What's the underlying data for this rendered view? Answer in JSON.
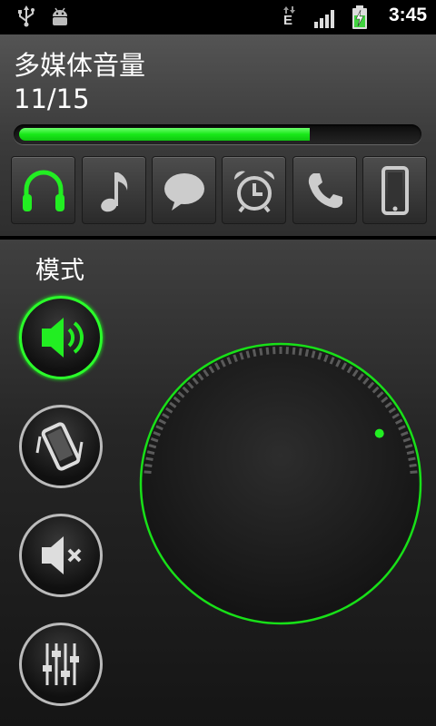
{
  "status_bar": {
    "time": "3:45",
    "network_type": "E",
    "icons": [
      "usb-icon",
      "android-debug-icon",
      "data-transfer-icon",
      "signal-icon",
      "battery-charging-icon"
    ]
  },
  "volume": {
    "title": "多媒体音量",
    "count_text": "11/15",
    "level": 11,
    "max": 15,
    "accent_color": "#22ee22"
  },
  "streams": [
    {
      "icon": "headphones-icon",
      "selected": true
    },
    {
      "icon": "music-note-icon",
      "selected": false
    },
    {
      "icon": "message-icon",
      "selected": false
    },
    {
      "icon": "alarm-clock-icon",
      "selected": false
    },
    {
      "icon": "phone-icon",
      "selected": false
    },
    {
      "icon": "device-icon",
      "selected": false
    }
  ],
  "mode": {
    "label": "模式",
    "buttons": [
      {
        "icon": "speaker-icon",
        "active": true
      },
      {
        "icon": "vibrate-icon",
        "active": false
      },
      {
        "icon": "mute-icon",
        "active": false
      },
      {
        "icon": "equalizer-icon",
        "active": false
      }
    ]
  },
  "knob": {
    "level": 11,
    "max": 15
  }
}
